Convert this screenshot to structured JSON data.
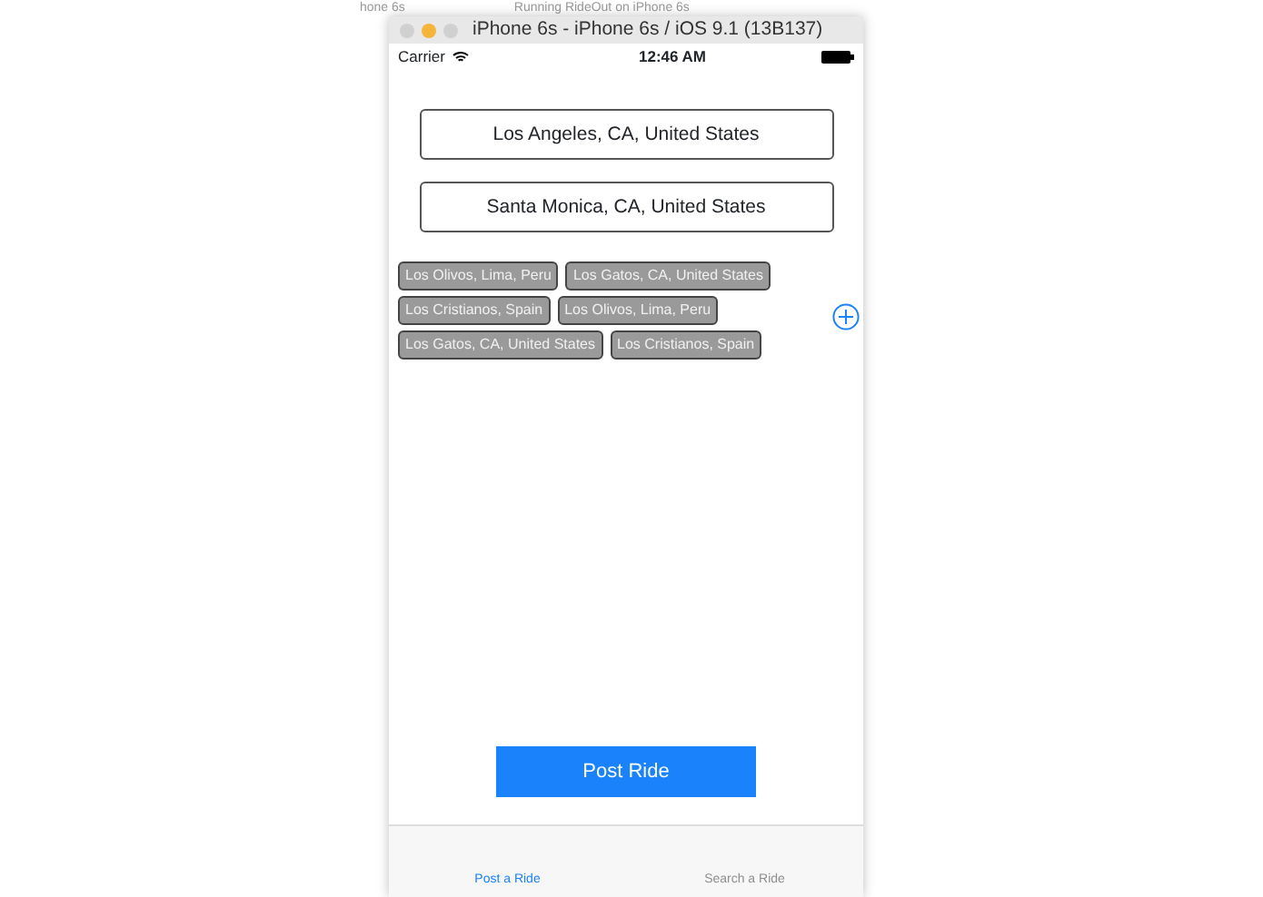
{
  "background_tabs": [
    "hone 6s",
    "Running RideOut on iPhone 6s"
  ],
  "window": {
    "title": "iPhone 6s - iPhone 6s / iOS 9.1 (13B137)"
  },
  "status_bar": {
    "carrier": "Carrier",
    "time": "12:46 AM"
  },
  "fields": [
    {
      "value": "Los Angeles, CA, United States"
    },
    {
      "value": "Santa Monica, CA, United States"
    }
  ],
  "tags": [
    {
      "label": "Los Olivos, Lima, Peru"
    },
    {
      "label": "Los Gatos, CA, United States"
    },
    {
      "label": "Los Cristianos, Spain"
    },
    {
      "label": "Los Olivos, Lima, Peru"
    },
    {
      "label": "Los Gatos, CA, United States"
    },
    {
      "label": "Los Cristianos, Spain"
    }
  ],
  "post_button": "Post Ride",
  "tabs": [
    {
      "label": "Post a Ride",
      "selected": true
    },
    {
      "label": "Search a Ride",
      "selected": false
    }
  ]
}
